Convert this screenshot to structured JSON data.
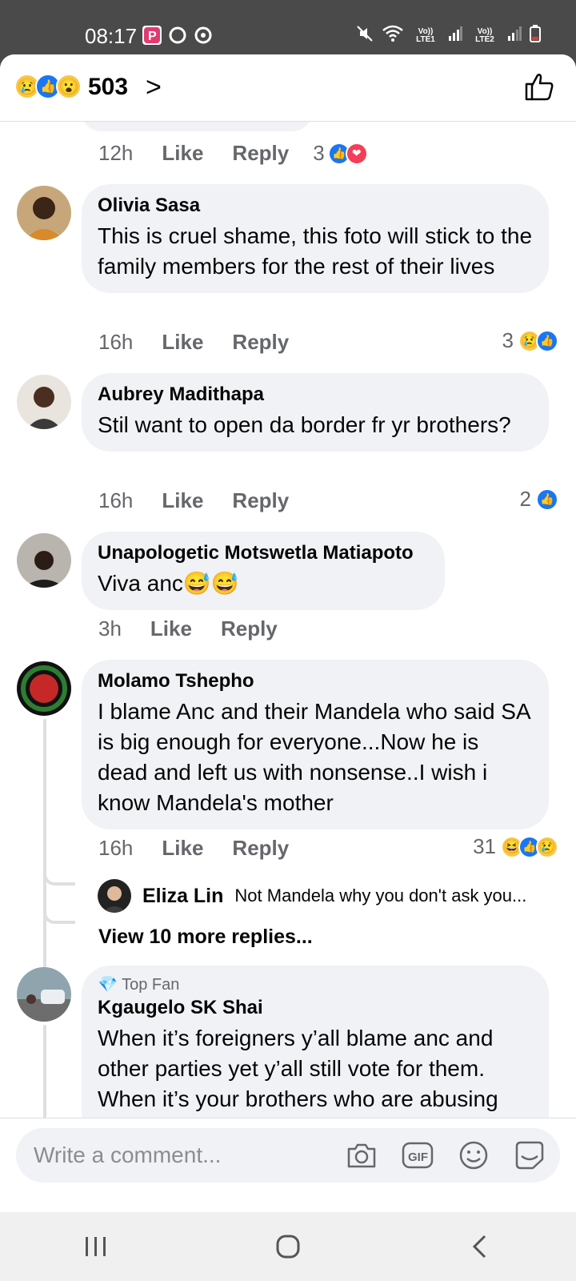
{
  "status_bar": {
    "time": "08:17",
    "lte1": "Vo)) LTE1",
    "lte2": "Vo)) LTE2"
  },
  "header": {
    "reaction_icons": [
      "sad-emoji",
      "like-emoji",
      "wow-emoji"
    ],
    "reaction_count": "503",
    "chevron": ">"
  },
  "comments": [
    {
      "time": "12h",
      "like": "Like",
      "reply": "Reply",
      "reaction_count": "3",
      "reaction_icons": [
        "like-emoji",
        "love-emoji"
      ]
    },
    {
      "name": "Olivia Sasa",
      "text": "This is cruel shame, this foto will stick to the family members for the rest of their lives",
      "time": "16h",
      "like": "Like",
      "reply": "Reply",
      "reaction_count": "3",
      "reaction_icons": [
        "sad-emoji",
        "like-emoji"
      ]
    },
    {
      "name": "Aubrey Madithapa",
      "text": "Stil want to open da border fr yr brothers?",
      "time": "16h",
      "like": "Like",
      "reply": "Reply",
      "reaction_count": "2",
      "reaction_icons": [
        "like-emoji"
      ]
    },
    {
      "name": "Unapologetic Motswetla Matiapoto",
      "text": "Viva anc😅😅",
      "time": "3h",
      "like": "Like",
      "reply": "Reply"
    },
    {
      "name": "Molamo Tshepho",
      "text": "I blame Anc and their Mandela who said SA is big enough for everyone...Now he is dead and left us with nonsense..I wish i know Mandela's mother",
      "time": "16h",
      "like": "Like",
      "reply": "Reply",
      "reaction_count": "31",
      "reaction_icons": [
        "haha-emoji",
        "like-emoji",
        "sad-emoji"
      ],
      "reply_preview": {
        "name": "Eliza Lin",
        "text": "Not Mandela why you don't ask you..."
      },
      "more_replies": "View 10 more replies..."
    },
    {
      "badge": "Top Fan",
      "name": "Kgaugelo SK Shai",
      "text": "When it’s foreigners y’all blame anc and other parties yet y’all still vote for them. When it’s your brothers who are abusing"
    }
  ],
  "input": {
    "placeholder": "Write a comment...",
    "tools": [
      "camera-icon",
      "gif-icon",
      "emoji-icon",
      "sticker-icon"
    ],
    "gif_label": "GIF"
  },
  "colors": {
    "accent": "#1877f2",
    "bubble": "#f0f2f5",
    "secondary_text": "#65676b"
  }
}
